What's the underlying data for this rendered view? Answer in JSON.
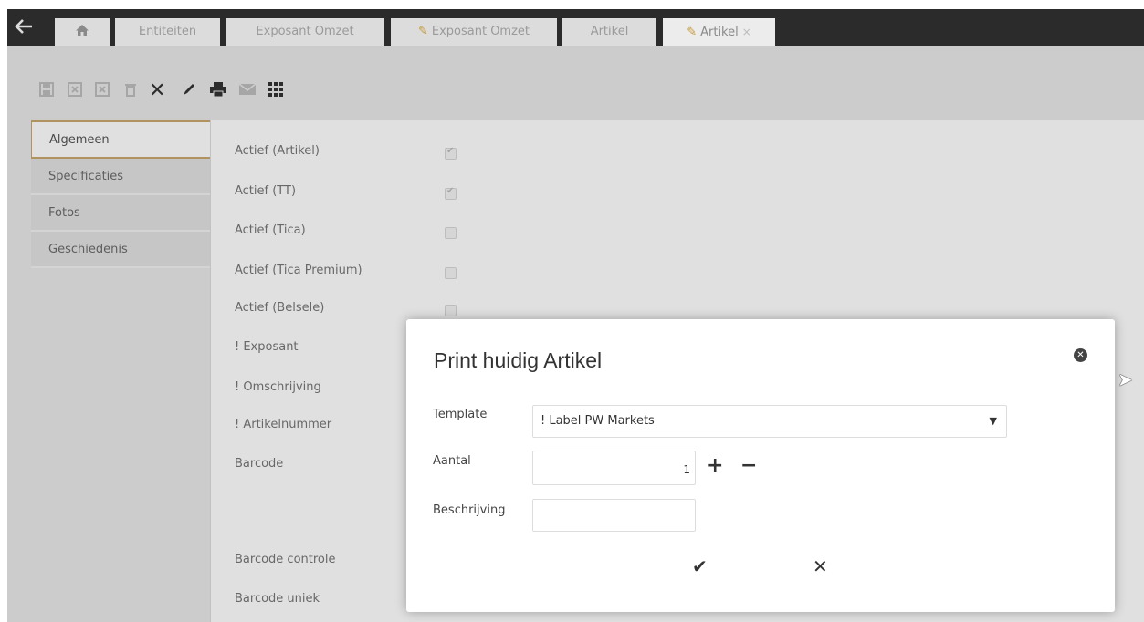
{
  "tabs": [
    {
      "label": "Entiteiten"
    },
    {
      "label": "Exposant Omzet"
    },
    {
      "label": "Exposant Omzet"
    },
    {
      "label": "Artikel"
    },
    {
      "label": "Artikel",
      "close": "×"
    }
  ],
  "sidenav": {
    "items": [
      {
        "label": "Algemeen"
      },
      {
        "label": "Specificaties"
      },
      {
        "label": "Fotos"
      },
      {
        "label": "Geschiedenis"
      }
    ]
  },
  "fields": [
    {
      "label": "Actief (Artikel)"
    },
    {
      "label": "Actief (TT)"
    },
    {
      "label": "Actief (Tica)"
    },
    {
      "label": "Actief (Tica Premium)"
    },
    {
      "label": "Actief (Belsele)"
    },
    {
      "label": "! Exposant"
    },
    {
      "label": "! Omschrijving"
    },
    {
      "label": "! Artikelnummer"
    },
    {
      "label": "Barcode"
    },
    {
      "label": "Barcode controle"
    },
    {
      "label": "Barcode uniek"
    }
  ],
  "modal": {
    "title": "Print huidig Artikel",
    "template_label": "Template",
    "template_value": "! Label PW Markets",
    "aantal_label": "Aantal",
    "aantal_value": "1",
    "beschrijving_label": "Beschrijving",
    "beschrijving_value": ""
  }
}
